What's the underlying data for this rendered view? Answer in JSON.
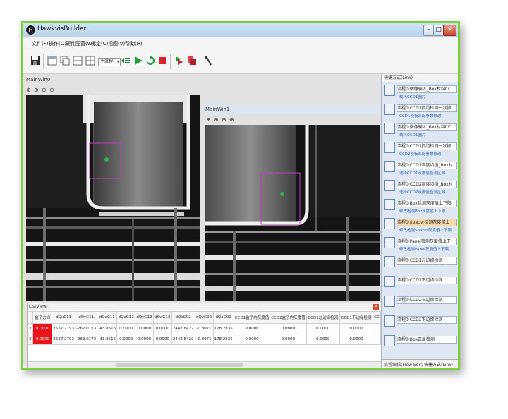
{
  "window": {
    "title": "HawkvisBuilder",
    "app_icon_glyph": "H",
    "controls": {
      "minimize": "–",
      "maximize": "□",
      "close": "✕"
    }
  },
  "menu": [
    "文件(F)",
    "操作(O)",
    "硬件配置(W)",
    "标定(C)",
    "视图(V)",
    "帮助(H)"
  ],
  "toolbar": {
    "flow_select_value": "主流程",
    "icons": [
      "save-icon",
      "window-layout-icon",
      "cascade-icon",
      "tile-icon",
      "grid-icon",
      "flow-list-icon",
      "run-icon",
      "loop-icon",
      "stop-icon",
      "step-forward-icon",
      "copy-icon",
      "tool-icon"
    ]
  },
  "views": {
    "left": {
      "title": "MainWin0"
    },
    "right": {
      "title": "MainWin1"
    },
    "zoom_icons": [
      "zoom-fit-icon",
      "zoom-in-icon",
      "zoom-out-icon",
      "zoom-reset-icon"
    ]
  },
  "listview": {
    "title": "ListView",
    "columns": [
      "盒子方向",
      "dQxC11",
      "dQyC11",
      "dQaC11",
      "dQxG12",
      "dQyG12",
      "dQaG12",
      "dQxG02",
      "dQyG02",
      "dQaG02",
      "CCD1盒子内灰度值",
      "CCD2盒子内灰度值",
      "CCD1左边缘检测",
      "CCD1下边缘检测",
      "CC"
    ],
    "rows": [
      {
        "index": "1",
        "cells": [
          "0.0000",
          "2537.2793",
          "-262.0173",
          "-43.8515",
          "0.0000",
          "0.0000",
          "0.0000",
          "2442.8422",
          "-0.8071",
          "178.2835",
          "0.0000",
          "0.0000",
          "0.0000",
          "0.0000",
          ""
        ]
      },
      {
        "index": "2",
        "cells": [
          "0.0000",
          "2537.2793",
          "-262.0173",
          "-43.8515",
          "0.0000",
          "0.0000",
          "0.0000",
          "2442.8422",
          "-0.8071",
          "178.2835",
          "0.0000",
          "0.0000",
          "0.0000",
          "0.0000",
          ""
        ]
      }
    ],
    "highlight_color": "#e8141a"
  },
  "right_panel": {
    "title": "快捷方式(Link)",
    "steps": [
      {
        "label": "流程0.图像输入_Box材料CC",
        "sub": "载入CCD1图片"
      },
      {
        "label": "流程0.CCD1抓边检测一次抓",
        "sub": "CCD1模板匹配参数修改"
      },
      {
        "label": "流程0.图像输入_Box材料CC",
        "sub": "载入CCD1图片"
      },
      {
        "label": "流程0.CCD2抓边检测一次抓",
        "sub": "CCD2模板匹配参数修改"
      },
      {
        "label": "流程0.CCD1灰度均值_Box材",
        "sub": "选择CCD1灰度值检测区域"
      },
      {
        "label": "流程0.CCD2灰度均值_Box材",
        "sub": "选择CCD2灰度值检测区域"
      },
      {
        "label": "流程0.Box检测灰度值上下限",
        "sub": "修改检测Box灰度值上下限"
      },
      {
        "label": "流程0.Spacer检测灰度值上",
        "sub": "修改检测Spacer灰度值上下限"
      },
      {
        "label": "流程0.Panel检测灰度值上下",
        "sub": "修改检测Panel灰度值上下限"
      },
      {
        "label": "流程0.CCD1左边缘检测",
        "sub": ""
      },
      {
        "label": "流程0.CCD1下边缘检测",
        "sub": ""
      },
      {
        "label": "流程0.CCD2右边缘检测",
        "sub": ""
      },
      {
        "label": "流程0.CCD2下边缘检测",
        "sub": ""
      },
      {
        "label": "流程0.Box正反检测",
        "sub": ""
      }
    ],
    "tabs": [
      "流程编辑(Flow Edit)",
      "快捷方式(Link)"
    ]
  },
  "colors": {
    "frame_border": "#7ccf3f",
    "roi_box": "#c040c0",
    "marker": "#2fb34a"
  }
}
